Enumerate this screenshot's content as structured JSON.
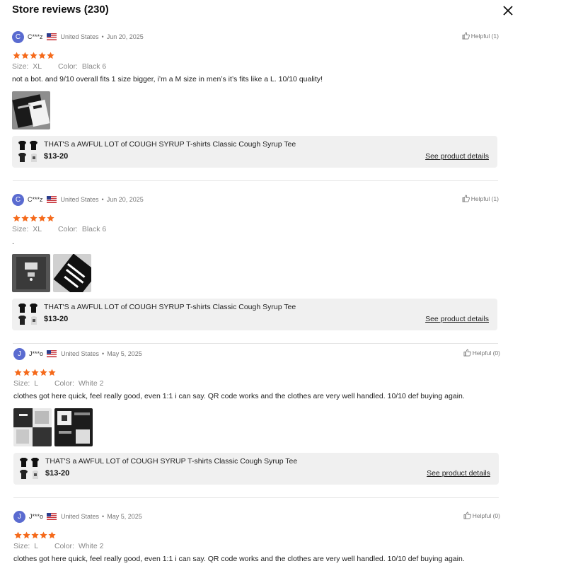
{
  "header": {
    "title": "Store reviews (230)",
    "close_icon": "close-icon"
  },
  "reviews": [
    {
      "avatar": "C",
      "user": "C***z",
      "country": "United States",
      "date": "Jun 20, 2025",
      "helpful": "Helpful (1)",
      "rating": 5,
      "size_label": "Size:",
      "size": "XL",
      "color_label": "Color:",
      "color": "Black 6",
      "text": "not a bot. and 9/10 overall fits 1 size bigger, i’m a M size in men’s it’s fits like a L. 10/10 quality!",
      "photos": [
        "black-shirt",
        "white-shirt"
      ],
      "product": {
        "name": "THAT'S a AWFUL LOT of COUGH SYRUP T-shirts Classic Cough Syrup Tee",
        "price": "$13-20",
        "link": "See product details"
      }
    },
    {
      "avatar": "C",
      "user": "C***z",
      "country": "United States",
      "date": "Jun 20, 2025",
      "helpful": "Helpful (1)",
      "rating": 5,
      "size_label": "Size:",
      "size": "XL",
      "color_label": "Color:",
      "color": "Black 6",
      "text": ".",
      "photos": [
        "gray-shirt",
        "print-shirt"
      ],
      "product": {
        "name": "THAT'S a AWFUL LOT of COUGH SYRUP T-shirts Classic Cough Syrup Tee",
        "price": "$13-20",
        "link": "See product details"
      }
    },
    {
      "avatar": "J",
      "user": "J***o",
      "country": "United States",
      "date": "May 5, 2025",
      "helpful": "Helpful (0)",
      "rating": 5,
      "size_label": "Size:",
      "size": "L",
      "color_label": "Color:",
      "color": "White 2",
      "text": "clothes got here quick, feel really good, even 1:1 i can say. QR code works and the clothes are very well handled. 10/10 def buying again.",
      "photos": [
        "bw-shirt",
        "bw-shirt-2"
      ],
      "product": {
        "name": "THAT'S a AWFUL LOT of COUGH SYRUP T-shirts Classic Cough Syrup Tee",
        "price": "$13-20",
        "link": "See product details"
      }
    },
    {
      "avatar": "J",
      "user": "J***o",
      "country": "United States",
      "date": "May 5, 2025",
      "helpful": "Helpful (0)",
      "rating": 5,
      "size_label": "Size:",
      "size": "L",
      "color_label": "Color:",
      "color": "White 2",
      "text": "clothes got here quick, feel really good, even 1:1 i can say. QR code works and the clothes are very well handled. 10/10 def buying again."
    }
  ],
  "colors": {
    "star": "#f56a1b",
    "avatar": "#5a6bd0",
    "card": "#f0f0f0"
  }
}
